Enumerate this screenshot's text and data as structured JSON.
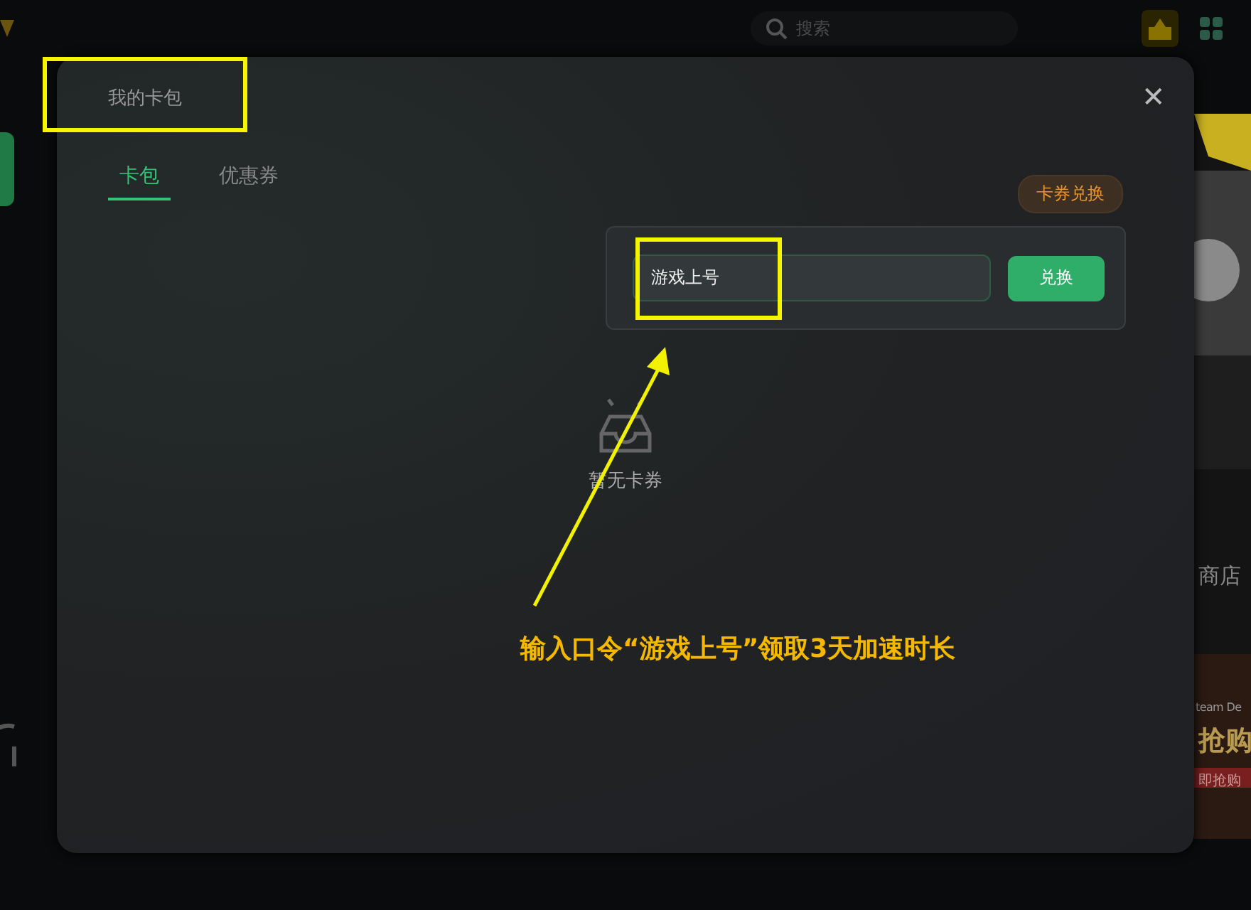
{
  "background": {
    "search": {
      "placeholder": "搜索"
    },
    "side_texts": [
      "商店",
      "team De",
      "抢购",
      "即抢购"
    ]
  },
  "dialog": {
    "title": "我的卡包",
    "close": "✕",
    "tabs": [
      {
        "label": "卡包",
        "selected": true
      },
      {
        "label": "优惠券",
        "selected": false
      }
    ],
    "redeem_toggle": "卡券兑换",
    "redeem_popover": {
      "code_value": "游戏上号",
      "button": "兑换"
    },
    "empty_text": "暂无卡券"
  },
  "annotation": {
    "caption": "输入口令“游戏上号”领取3天加速时长"
  }
}
